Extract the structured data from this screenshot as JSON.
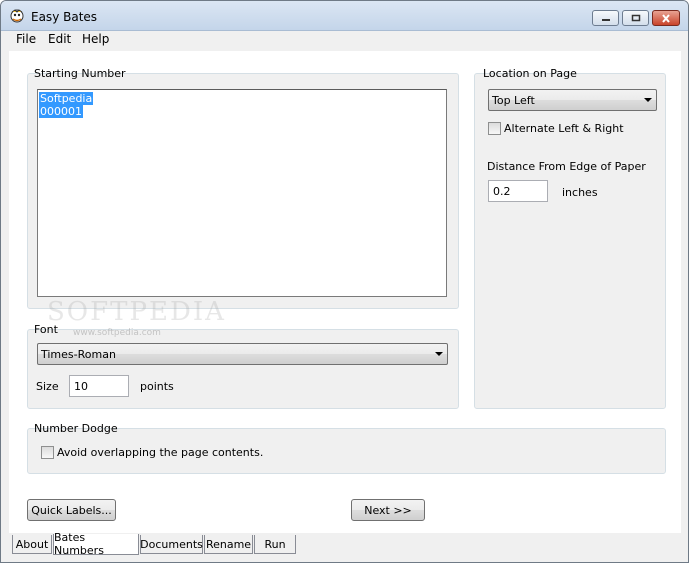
{
  "window": {
    "title": "Easy Bates"
  },
  "menu": {
    "file": "File",
    "edit": "Edit",
    "help": "Help"
  },
  "starting_number": {
    "label": "Starting Number",
    "lines": [
      "Softpedia",
      "000001"
    ]
  },
  "font": {
    "label": "Font",
    "selected": "Times-Roman",
    "size_label": "Size",
    "size_value": "10",
    "points_label": "points"
  },
  "location": {
    "label": "Location on Page",
    "selected": "Top Left",
    "alternate_label": "Alternate Left & Right",
    "distance_label": "Distance From Edge of Paper",
    "distance_value": "0.2",
    "inches_label": "inches"
  },
  "number_dodge": {
    "label": "Number Dodge",
    "avoid_label": "Avoid overlapping the page contents."
  },
  "buttons": {
    "quick_labels": "Quick Labels...",
    "next": "Next >>"
  },
  "watermark": {
    "text": "SOFTPEDIA",
    "sub": "www.softpedia.com"
  },
  "tabs": [
    {
      "label": "About"
    },
    {
      "label": "Bates Numbers"
    },
    {
      "label": "Documents"
    },
    {
      "label": "Rename"
    },
    {
      "label": "Run"
    }
  ]
}
